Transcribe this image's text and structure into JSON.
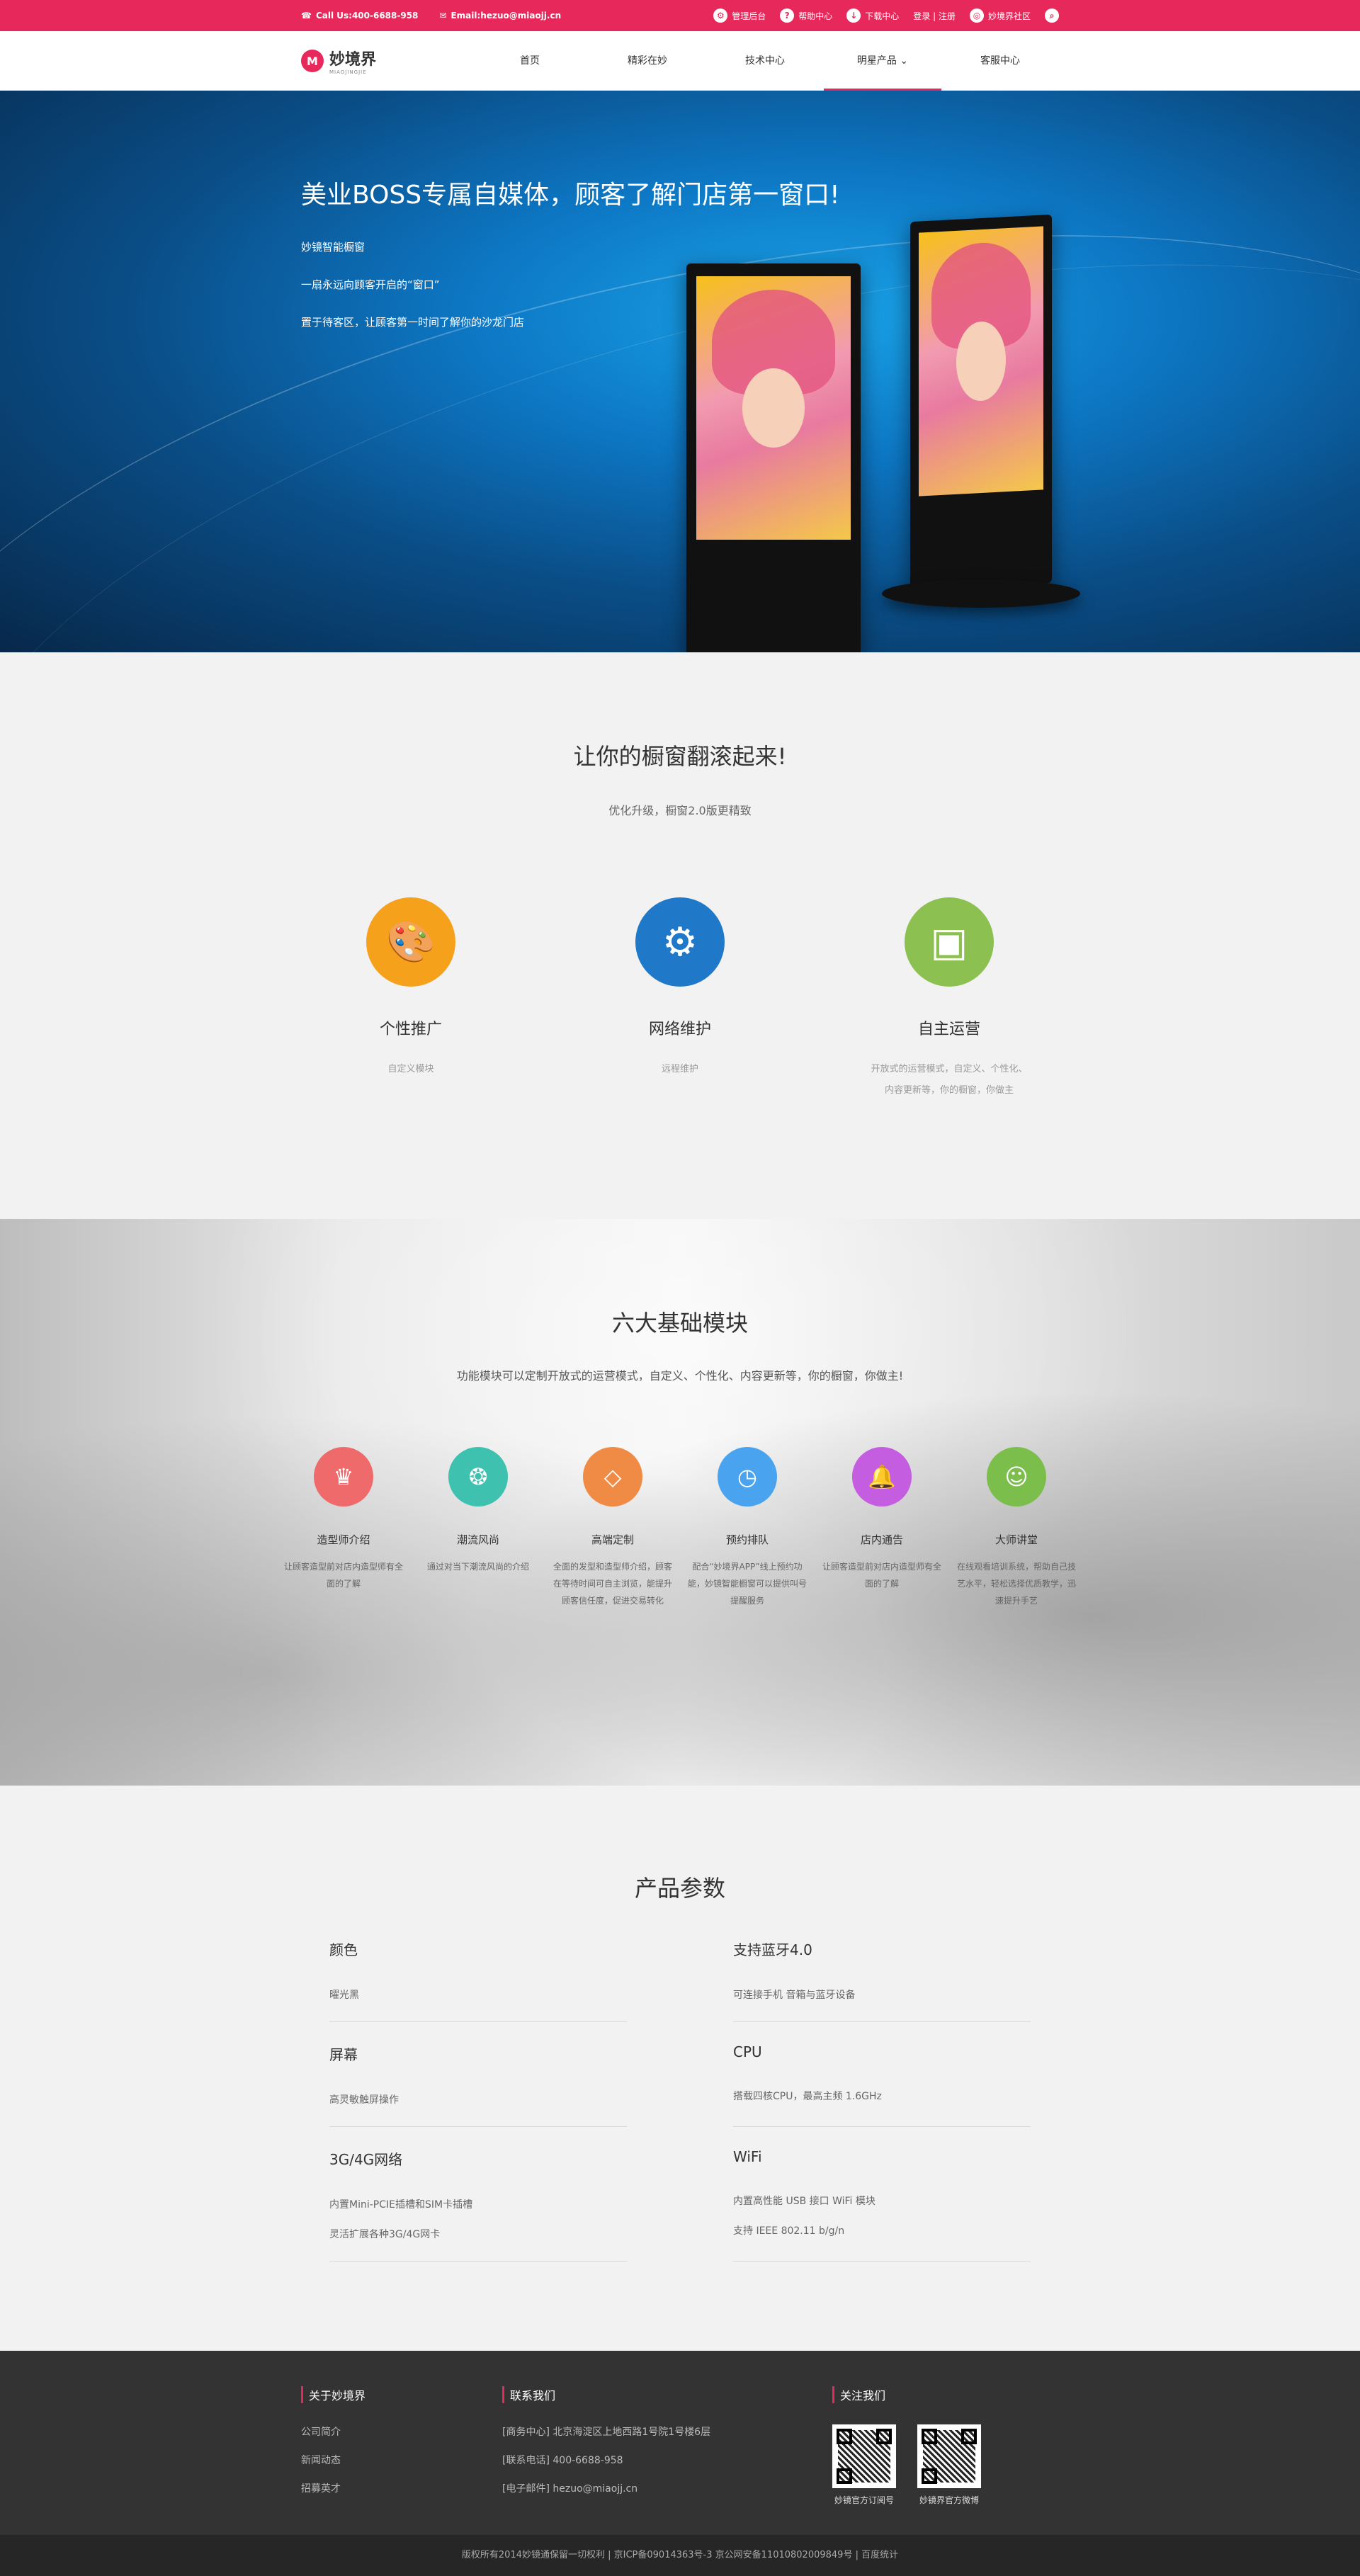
{
  "topbar": {
    "call": "Call Us:400-6688-958",
    "email": "Email:hezuo@miaojj.cn",
    "links": [
      "管理后台",
      "帮助中心",
      "下载中心",
      "登录 | 注册",
      "妙境界社区"
    ]
  },
  "nav": {
    "logo_text": "妙境界",
    "logo_sub": "MIAOJINGJIE",
    "items": [
      "首页",
      "精彩在妙",
      "技术中心",
      "明星产品",
      "客服中心"
    ]
  },
  "hero": {
    "title": "美业BOSS专属自媒体，顾客了解门店第一窗口!",
    "lines": [
      "妙镜智能橱窗",
      "一扇永远向顾客开启的“窗口”",
      "置于待客区，让顾客第一时间了解你的沙龙门店"
    ]
  },
  "section2": {
    "title": "让你的橱窗翻滚起来!",
    "subtitle": "优化升级，橱窗2.0版更精致",
    "features": [
      {
        "title": "个性推广",
        "desc": "自定义模块",
        "color": "#f5a11c",
        "icon": "palette-icon"
      },
      {
        "title": "网络维护",
        "desc": "远程维护",
        "color": "#1f78c8",
        "icon": "gear-icon"
      },
      {
        "title": "自主运营",
        "desc": "开放式的运营模式，自定义、个性化、内容更新等，你的橱窗，你做主",
        "color": "#8cc152",
        "icon": "chat-icon"
      }
    ]
  },
  "section3": {
    "title": "六大基础模块",
    "subtitle": "功能模块可以定制开放式的运营模式，自定义、个性化、内容更新等，你的橱窗，你做主!",
    "modules": [
      {
        "title": "造型师介绍",
        "desc": "让顾客造型前对店内造型师有全面的了解",
        "color": "#ef6a6a",
        "icon": "hat-icon"
      },
      {
        "title": "潮流风尚",
        "desc": "通过对当下潮流风尚的介绍",
        "color": "#3fc1b0",
        "icon": "swirl-icon"
      },
      {
        "title": "高端定制",
        "desc": "全面的发型和造型师介绍，顾客在等待时间可自主浏览，能提升顾客信任度，促进交易转化",
        "color": "#ef8b45",
        "icon": "diamond-icon"
      },
      {
        "title": "预约排队",
        "desc": "配合“妙境界APP”线上预约功能，妙镜智能橱窗可以提供叫号提醒服务",
        "color": "#4aa3ef",
        "icon": "clock-icon"
      },
      {
        "title": "店内通告",
        "desc": "让顾客造型前对店内造型师有全面的了解",
        "color": "#c55de0",
        "icon": "bell-icon"
      },
      {
        "title": "大师讲堂",
        "desc": "在线观看培训系统，帮助自己技艺水平，轻松选择优质教学，迅速提升手艺",
        "color": "#7cbe4b",
        "icon": "teacher-icon"
      }
    ]
  },
  "section4": {
    "title": "产品参数",
    "params": [
      {
        "name": "颜色",
        "values": [
          "曜光黑"
        ]
      },
      {
        "name": "支持蓝牙4.0",
        "values": [
          "可连接手机 音箱与蓝牙设备"
        ]
      },
      {
        "name": "屏幕",
        "values": [
          "高灵敏触屏操作"
        ]
      },
      {
        "name": "CPU",
        "values": [
          "搭载四核CPU，最高主频 1.6GHz"
        ]
      },
      {
        "name": "3G/4G网络",
        "values": [
          "内置Mini-PCIE插槽和SIM卡插槽",
          "灵活扩展各种3G/4G网卡"
        ]
      },
      {
        "name": "WiFi",
        "values": [
          "内置高性能 USB 接口 WiFi 模块",
          "支持 IEEE 802.11 b/g/n"
        ]
      }
    ]
  },
  "footer": {
    "about_title": "关于妙境界",
    "about_links": [
      "公司简介",
      "新闻动态",
      "招募英才"
    ],
    "contact_title": "联系我们",
    "contact_lines": [
      "[商务中心] 北京海淀区上地西路1号院1号楼6层",
      "[联系电话] 400-6688-958",
      "[电子邮件] hezuo@miaojj.cn"
    ],
    "follow_title": "关注我们",
    "qr_labels": [
      "妙镜官方订阅号",
      "妙镜界官方微博"
    ],
    "copyright": "版权所有2014妙镜通保留一切权利 | 京ICP备09014363号-3 京公网安备11010802009849号 | 百度统计"
  },
  "colors": {
    "brand": "#e6295a",
    "footer_bg": "#333333"
  }
}
